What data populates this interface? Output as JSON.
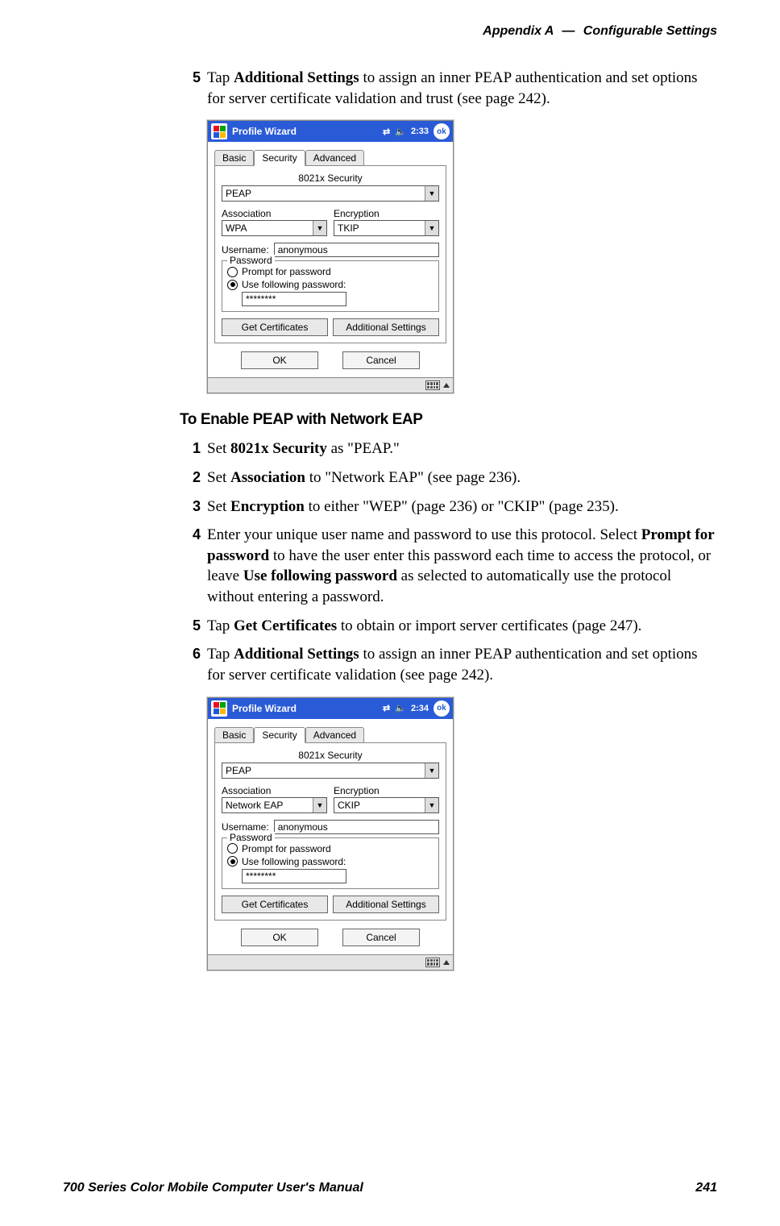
{
  "header": {
    "appendix": "Appendix A",
    "dash": "—",
    "section": "Configurable Settings"
  },
  "intro_step": {
    "num": "5",
    "text_pre": "Tap ",
    "bold1": "Additional Settings",
    "text_post": " to assign an inner PEAP authentication and set options for server certificate validation and trust (see page 242)."
  },
  "figure1": {
    "title": "Profile Wizard",
    "time": "2:33",
    "ok": "ok",
    "tabs": {
      "basic": "Basic",
      "security": "Security",
      "advanced": "Advanced"
    },
    "sec_label": "8021x Security",
    "sec_value": "PEAP",
    "assoc_label": "Association",
    "assoc_value": "WPA",
    "enc_label": "Encryption",
    "enc_value": "TKIP",
    "username_label": "Username:",
    "username_value": "anonymous",
    "password_legend": "Password",
    "radio_prompt": "Prompt for password",
    "radio_use": "Use following password:",
    "password_value": "********",
    "btn_getcerts": "Get Certificates",
    "btn_addl": "Additional Settings",
    "btn_ok": "OK",
    "btn_cancel": "Cancel"
  },
  "heading2": "To Enable PEAP with Network EAP",
  "steps2": {
    "s1": {
      "num": "1",
      "pre": "Set ",
      "b1": "8021x Security",
      "post": " as \"PEAP.\""
    },
    "s2": {
      "num": "2",
      "pre": "Set ",
      "b1": "Association",
      "post": " to \"Network EAP\" (see page 236)."
    },
    "s3": {
      "num": "3",
      "pre": "Set ",
      "b1": "Encryption",
      "post": " to either \"WEP\" (page 236) or \"CKIP\" (page 235)."
    },
    "s4": {
      "num": "4",
      "pre": "Enter your unique user name and password to use this protocol. Select ",
      "b1": "Prompt for password",
      "mid": " to have the user enter this password each time to access the protocol, or leave ",
      "b2": "Use following password",
      "post": " as selected to automatically use the protocol without entering a password."
    },
    "s5": {
      "num": "5",
      "pre": "Tap ",
      "b1": "Get Certificates",
      "post": " to obtain or import server certificates (page 247)."
    },
    "s6": {
      "num": "6",
      "pre": "Tap ",
      "b1": "Additional Settings",
      "post": " to assign an inner PEAP authentication and set options for server certificate validation (see page 242)."
    }
  },
  "figure2": {
    "title": "Profile Wizard",
    "time": "2:34",
    "ok": "ok",
    "tabs": {
      "basic": "Basic",
      "security": "Security",
      "advanced": "Advanced"
    },
    "sec_label": "8021x Security",
    "sec_value": "PEAP",
    "assoc_label": "Association",
    "assoc_value": "Network EAP",
    "enc_label": "Encryption",
    "enc_value": "CKIP",
    "username_label": "Username:",
    "username_value": "anonymous",
    "password_legend": "Password",
    "radio_prompt": "Prompt for password",
    "radio_use": "Use following password:",
    "password_value": "********",
    "btn_getcerts": "Get Certificates",
    "btn_addl": "Additional Settings",
    "btn_ok": "OK",
    "btn_cancel": "Cancel"
  },
  "footer": {
    "left": "700 Series Color Mobile Computer User's Manual",
    "right": "241"
  }
}
